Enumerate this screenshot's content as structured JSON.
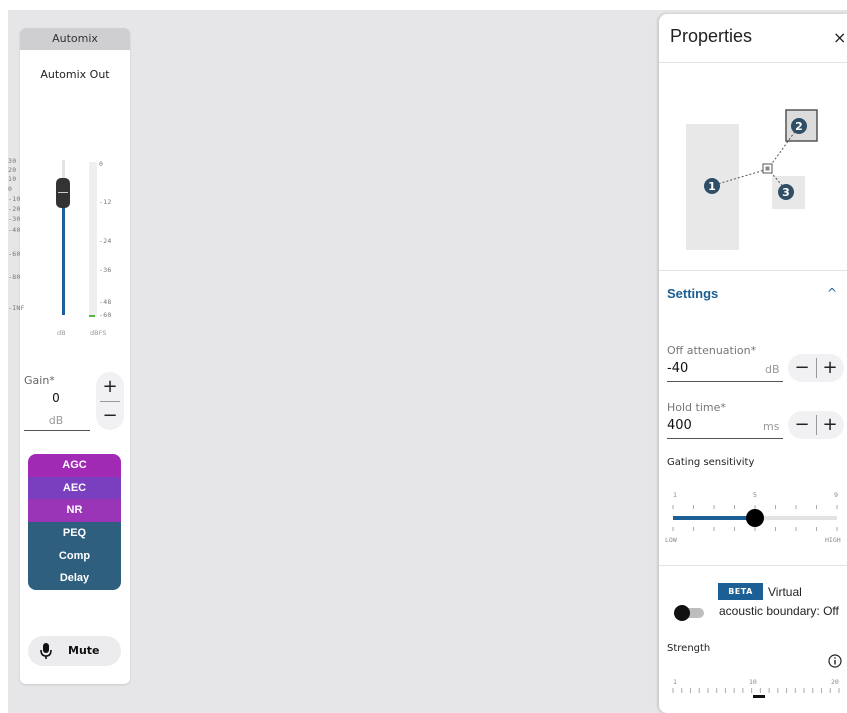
{
  "strip": {
    "title": "Automix",
    "label": "Automix Out",
    "db_scale": [
      "30",
      "20",
      "10",
      "0",
      "-10",
      "-20",
      "-30",
      "-40",
      "-60",
      "-80",
      "-INF"
    ],
    "dbfs_scale": [
      "0",
      "-12",
      "-24",
      "-36",
      "-48",
      "-60"
    ],
    "db_unit": "dB",
    "dbfs_unit": "dBFS",
    "gain_label": "Gain*",
    "gain_value": "0",
    "gain_unit": "dB",
    "plus": "+",
    "minus": "−",
    "blocks": [
      {
        "label": "AGC",
        "color": "#a12ab5"
      },
      {
        "label": "AEC",
        "color": "#7a3fbf"
      },
      {
        "label": "NR",
        "color": "#9a35b8"
      },
      {
        "label": "PEQ",
        "color": "#2f5f7e"
      },
      {
        "label": "Comp",
        "color": "#2f5f7e"
      },
      {
        "label": "Delay",
        "color": "#2f5f7e"
      }
    ],
    "mute_label": "Mute",
    "mute_icon": "microphone-icon"
  },
  "panel": {
    "title": "Properties",
    "close": "×",
    "diagram_badges": [
      "1",
      "2",
      "3"
    ],
    "settings": "Settings",
    "settings_chevron": "^",
    "off_attenuation": {
      "label": "Off attenuation*",
      "value": "-40",
      "unit": "dB"
    },
    "hold_time": {
      "label": "Hold time*",
      "value": "400",
      "unit": "ms"
    },
    "gating": {
      "label": "Gating sensitivity",
      "ticks": [
        "1",
        "5",
        "9"
      ],
      "low": "LOW",
      "high": "HIGH",
      "min": 1,
      "max": 9,
      "value": 5
    },
    "beta": "BETA",
    "vab_line1": "Virtual",
    "vab_line2": "acoustic boundary: Off",
    "vab_toggle": "off",
    "strength": {
      "label": "Strength",
      "ticks": [
        "1",
        "10",
        "20"
      ]
    },
    "accent": "#1b5f95"
  }
}
